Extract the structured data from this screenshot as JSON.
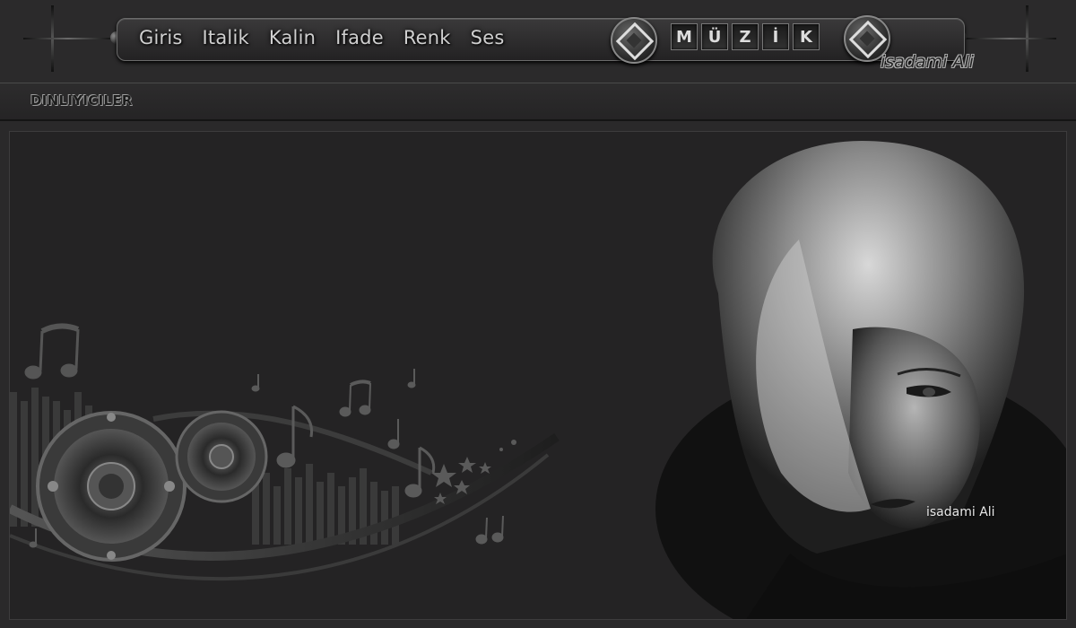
{
  "nav": [
    "Giris",
    "Italik",
    "Kalin",
    "Ifade",
    "Renk",
    "Ses"
  ],
  "title_letters": [
    "M",
    "Ü",
    "Z",
    "İ",
    "K"
  ],
  "brand": "isadami Ali",
  "subheader": {
    "label": "DINLIYICILER"
  },
  "artwork": {
    "watermark": "isadami Ali"
  },
  "colors": {
    "background": "#2a292a",
    "panel": "#242324",
    "text": "#cfcfcf"
  },
  "icons": [
    "diamond-icon",
    "music-note-icon",
    "speaker-icon"
  ]
}
